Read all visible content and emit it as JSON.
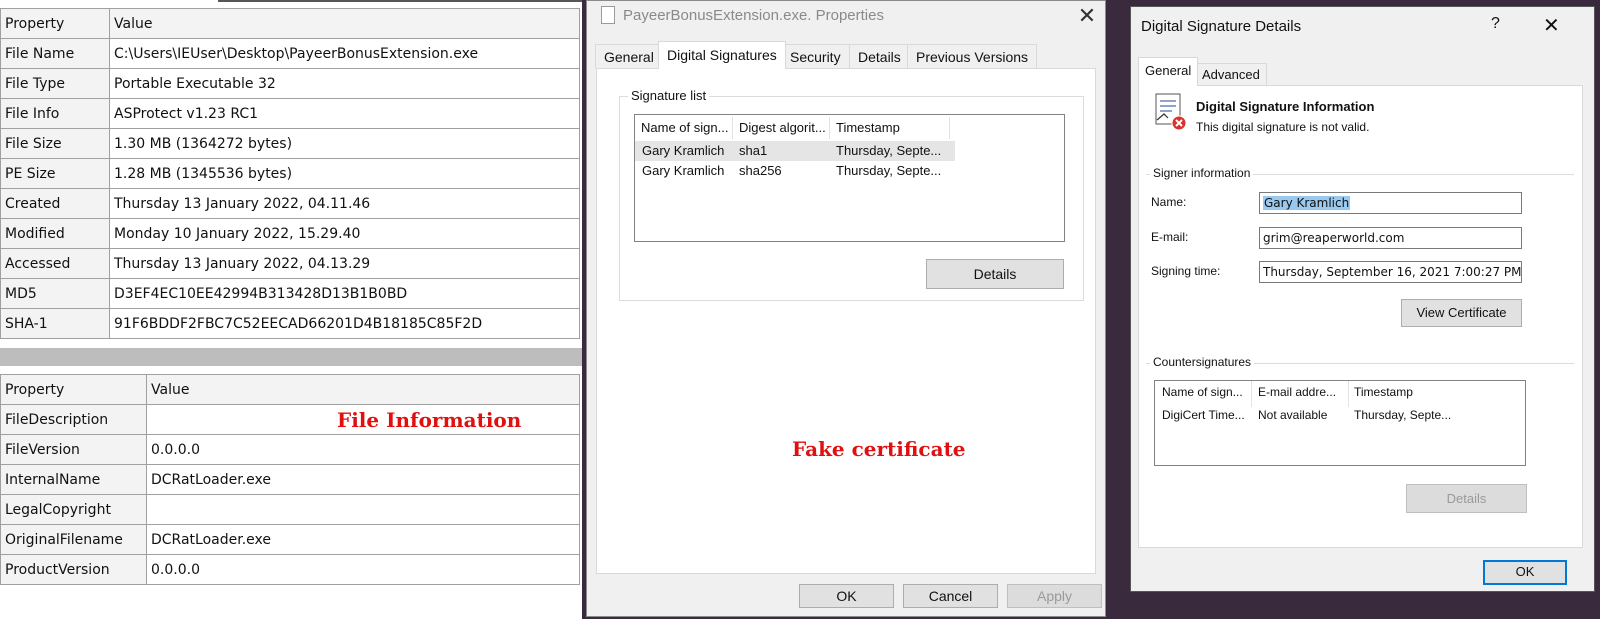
{
  "file_table": {
    "header": {
      "property": "Property",
      "value": "Value"
    },
    "rows": [
      {
        "key": "File Name",
        "value": "C:\\Users\\IEUser\\Desktop\\PayeerBonusExtension.exe"
      },
      {
        "key": "File Type",
        "value": "Portable Executable 32"
      },
      {
        "key": "File Info",
        "value": "ASProtect v1.23 RC1"
      },
      {
        "key": "File Size",
        "value": "1.30 MB (1364272 bytes)"
      },
      {
        "key": "PE Size",
        "value": "1.28 MB (1345536 bytes)"
      },
      {
        "key": "Created",
        "value": "Thursday 13 January 2022, 04.11.46"
      },
      {
        "key": "Modified",
        "value": "Monday 10 January 2022, 15.29.40"
      },
      {
        "key": "Accessed",
        "value": "Thursday 13 January 2022, 04.13.29"
      },
      {
        "key": "MD5",
        "value": "D3EF4EC10EE42994B313428D13B1B0BD"
      },
      {
        "key": "SHA-1",
        "value": "91F6BDDF2FBC7C52EECAD66201D4B18185C85F2D"
      }
    ]
  },
  "version_table": {
    "header": {
      "property": "Property",
      "value": "Value"
    },
    "rows": [
      {
        "key": "FileDescription",
        "value": ""
      },
      {
        "key": "FileVersion",
        "value": "0.0.0.0"
      },
      {
        "key": "InternalName",
        "value": "DCRatLoader.exe"
      },
      {
        "key": "LegalCopyright",
        "value": ""
      },
      {
        "key": "OriginalFilename",
        "value": "DCRatLoader.exe"
      },
      {
        "key": "ProductVersion",
        "value": "0.0.0.0"
      }
    ]
  },
  "annotations": {
    "file_information": "File Information",
    "fake_certificate": "Fake certificate"
  },
  "properties_dialog": {
    "title": "PayeerBonusExtension.exe.   Properties",
    "close_glyph": "✕",
    "tabs": [
      "General",
      "Digital Signatures",
      "Security",
      "Details",
      "Previous Versions"
    ],
    "active_tab": "Digital Signatures",
    "signature_list_label": "Signature list",
    "columns": [
      "Name of sign...",
      "Digest algorit...",
      "Timestamp"
    ],
    "rows": [
      {
        "name": "Gary Kramlich",
        "digest": "sha1",
        "timestamp": "Thursday, Septe..."
      },
      {
        "name": "Gary Kramlich",
        "digest": "sha256",
        "timestamp": "Thursday, Septe..."
      }
    ],
    "details_button": "Details",
    "ok_button": "OK",
    "cancel_button": "Cancel",
    "apply_button": "Apply"
  },
  "signature_details": {
    "title": "Digital Signature Details",
    "help_glyph": "?",
    "close_glyph": "✕",
    "tabs": [
      "General",
      "Advanced"
    ],
    "active_tab": "General",
    "info_title": "Digital Signature Information",
    "info_status": "This digital signature is not valid.",
    "signer_group": "Signer information",
    "name_label": "Name:",
    "name_value": "Gary Kramlich",
    "email_label": "E-mail:",
    "email_value": "grim@reaperworld.com",
    "signing_time_label": "Signing time:",
    "signing_time_value": "Thursday, September 16, 2021 7:00:27 PM",
    "view_certificate_button": "View Certificate",
    "countersignatures_group": "Countersignatures",
    "cs_columns": [
      "Name of sign...",
      "E-mail addre...",
      "Timestamp"
    ],
    "cs_rows": [
      {
        "name": "DigiCert Time...",
        "email": "Not available",
        "timestamp": "Thursday, Septe..."
      }
    ],
    "details_button": "Details",
    "ok_button": "OK"
  },
  "colors": {
    "annotation": "#e01010",
    "selection": "#99c9ef",
    "accent": "#0078d7"
  }
}
